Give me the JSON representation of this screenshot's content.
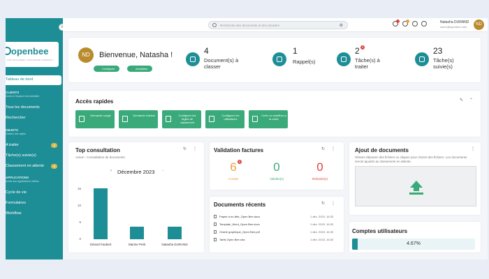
{
  "sidebar": {
    "logo": "openbee",
    "logo_sub": "THE DOCUMENT SOFTWARE COMPANY",
    "items": [
      {
        "label": "Tableau de bord"
      },
      {
        "label": "Tous les documents"
      },
      {
        "label": "Rechercher"
      },
      {
        "label": "A traiter",
        "badge": "2"
      },
      {
        "label": "Tâche(s) suivie(s)"
      },
      {
        "label": "Classement en attente",
        "badge": "6"
      },
      {
        "label": "Cycle de vie"
      },
      {
        "label": "Formulaires"
      },
      {
        "label": "Workflow"
      }
    ],
    "sections": [
      {
        "title": "CLIENTS",
        "sub": "Accès à l'espace documentaire"
      },
      {
        "title": "OBJETS",
        "sub": "Gestion des objets"
      },
      {
        "title": "APPLICATIONS",
        "sub": "Accès aux applications métiers"
      }
    ]
  },
  "topbar": {
    "search_placeholder": "Recherche des documents et des dossiers",
    "user_name": "Natasha DURAND",
    "user_email": "user1@openbee.com",
    "user_initials": "ND"
  },
  "welcome": {
    "initials": "ND",
    "title": "Bienvenue, Natasha !",
    "configure": "Configurer",
    "refresh": "Actualiser"
  },
  "stats": [
    {
      "value": "4",
      "label": "Document(s) à classer"
    },
    {
      "value": "1",
      "label": "Rappel(s)"
    },
    {
      "value": "2",
      "label": "Tâche(s) à traiter",
      "badge": "2"
    },
    {
      "value": "23",
      "label": "Tâche(s) suivie(s)"
    }
  ],
  "quick_access": {
    "title": "Accès rapides",
    "buttons": [
      {
        "label": "Demande congé"
      },
      {
        "label": "Demande d'achat"
      },
      {
        "label": "Configurer les règles de classement"
      },
      {
        "label": "Configurer les utilisateurs"
      },
      {
        "label": "Créer un workflow à la volée"
      }
    ]
  },
  "top_consultation": {
    "title": "Top consultation",
    "subtitle": "Action : Consultation de documents",
    "month": "Décembre 2023"
  },
  "chart_data": {
    "type": "bar",
    "categories": [
      "Gérard Faubert",
      "Marine Petit",
      "Natasha DURAND"
    ],
    "values": [
      16,
      4,
      4
    ],
    "yticks": [
      "15",
      "10",
      "5",
      "0"
    ],
    "ylim": [
      0,
      17
    ]
  },
  "validation": {
    "title": "Validation factures",
    "items": [
      {
        "value": "6",
        "label": "A traiter",
        "color": "#e8a33c",
        "badge": "6"
      },
      {
        "value": "0",
        "label": "Validée(s)",
        "color": "#3aaa7a"
      },
      {
        "value": "0",
        "label": "Refusée(s)",
        "color": "#e0433b"
      }
    ]
  },
  "recent_docs": {
    "title": "Documents récents",
    "rows": [
      {
        "name": "Papier à en-tête_Open Bee.docx",
        "date": "1 déc. 2023, 16:33"
      },
      {
        "name": "Template_Word_Open Bee.docx",
        "date": "1 déc. 2023, 16:33"
      },
      {
        "name": "Charte graphique_Open Bee.pdf",
        "date": "1 déc. 2023, 16:33"
      },
      {
        "name": "Tarifs Open Bee.xlsx",
        "date": "1 déc. 2023, 16:33"
      }
    ]
  },
  "upload": {
    "title": "Ajout de documents",
    "desc": "Glissez-déposez des fichiers ou cliquez pour choisir des fichiers. Les documents seront ajoutés au classement en attente."
  },
  "accounts": {
    "title": "Comptes utilisateurs",
    "percent_text": "4.67%",
    "fraction": 0.0467
  }
}
